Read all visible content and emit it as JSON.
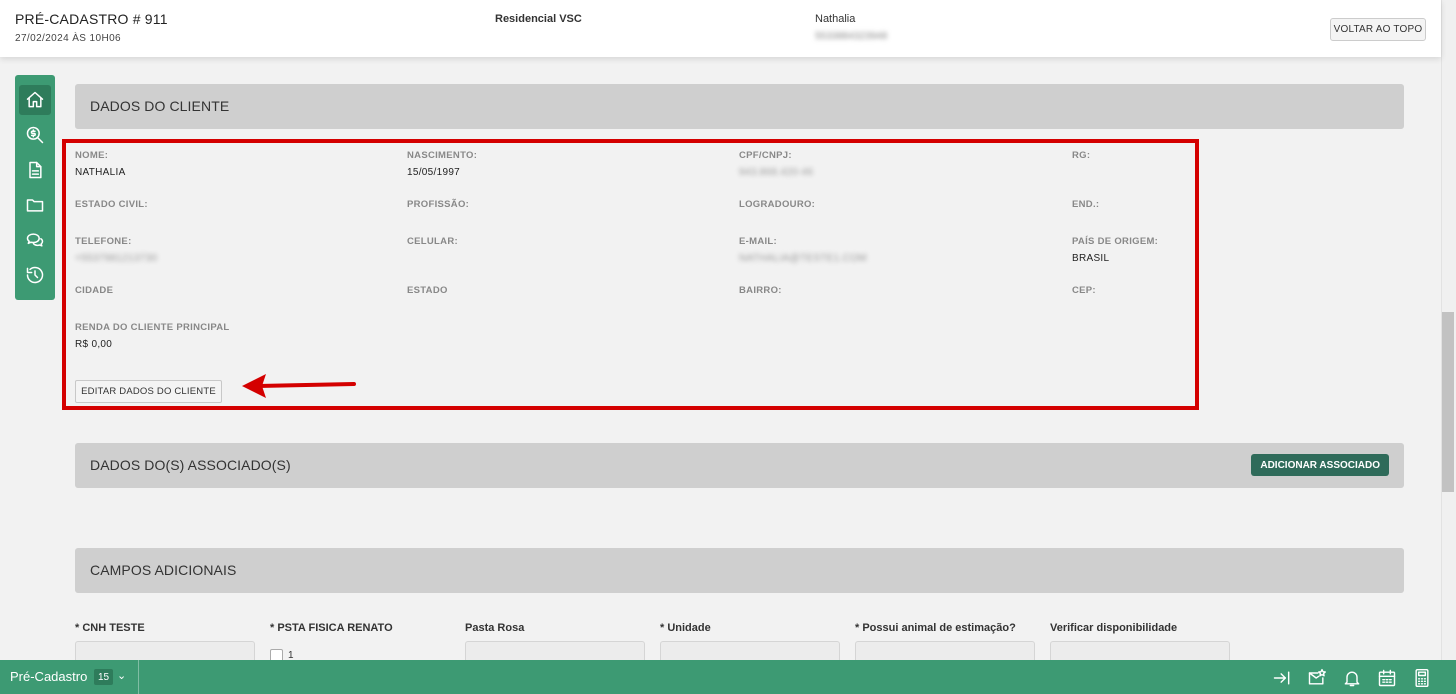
{
  "header": {
    "title": "PRÉ-CADASTRO # 911",
    "date": "27/02/2024 ÀS 10H06",
    "project": "Residencial VSC",
    "client_name": "Nathalia",
    "client_phone": "5533884323948",
    "top_button": "VOLTAR AO TOPO"
  },
  "sidenav": {
    "icons": [
      "home-icon",
      "search-dollar-icon",
      "document-icon",
      "folder-icon",
      "chat-icon",
      "history-icon"
    ]
  },
  "client_section": {
    "title": "DADOS DO CLIENTE",
    "fields": {
      "nome": {
        "label": "NOME:",
        "value": "NATHALIA"
      },
      "nascimento": {
        "label": "NASCIMENTO:",
        "value": "15/05/1997"
      },
      "cpf": {
        "label": "CPF/CNPJ:",
        "value": "943.868.420-46"
      },
      "rg": {
        "label": "RG:",
        "value": ""
      },
      "estado_civil": {
        "label": "ESTADO CIVIL:",
        "value": ""
      },
      "profissao": {
        "label": "PROFISSÃO:",
        "value": ""
      },
      "logradouro": {
        "label": "LOGRADOURO:",
        "value": ""
      },
      "end": {
        "label": "END.:",
        "value": ""
      },
      "telefone": {
        "label": "TELEFONE:",
        "value": "+5537981213730"
      },
      "celular": {
        "label": "CELULAR:",
        "value": ""
      },
      "email": {
        "label": "E-MAIL:",
        "value": "NATHALIA@TESTE1.COM"
      },
      "pais": {
        "label": "PAÍS DE ORIGEM:",
        "value": "BRASIL"
      },
      "cidade": {
        "label": "CIDADE",
        "value": ""
      },
      "estado": {
        "label": "ESTADO",
        "value": ""
      },
      "bairro": {
        "label": "BAIRRO:",
        "value": ""
      },
      "cep": {
        "label": "CEP:",
        "value": ""
      },
      "renda": {
        "label": "RENDA DO CLIENTE PRINCIPAL",
        "value": "R$ 0,00"
      }
    },
    "edit_button": "EDITAR DADOS DO CLIENTE"
  },
  "associates_section": {
    "title": "DADOS DO(S) ASSOCIADO(S)",
    "add_button": "ADICIONAR ASSOCIADO"
  },
  "additional_section": {
    "title": "CAMPOS ADICIONAIS",
    "fields": [
      {
        "label": "* CNH TESTE"
      },
      {
        "label": "* PSTA FISICA RENATO",
        "checkbox_label": "1"
      },
      {
        "label": "Pasta Rosa"
      },
      {
        "label": "* Unidade"
      },
      {
        "label": "* Possui animal de estimação?"
      },
      {
        "label": "Verificar disponibilidade"
      }
    ]
  },
  "bottombar": {
    "label": "Pré-Cadastro",
    "count": "15",
    "chevron": "⌄",
    "icons": [
      "collapse-right-icon",
      "mail-star-icon",
      "bell-icon",
      "calendar-icon",
      "calculator-icon"
    ]
  },
  "colors": {
    "green": "#3d9a73",
    "dark_green": "#2f6b5a",
    "highlight_red": "#d40000"
  }
}
